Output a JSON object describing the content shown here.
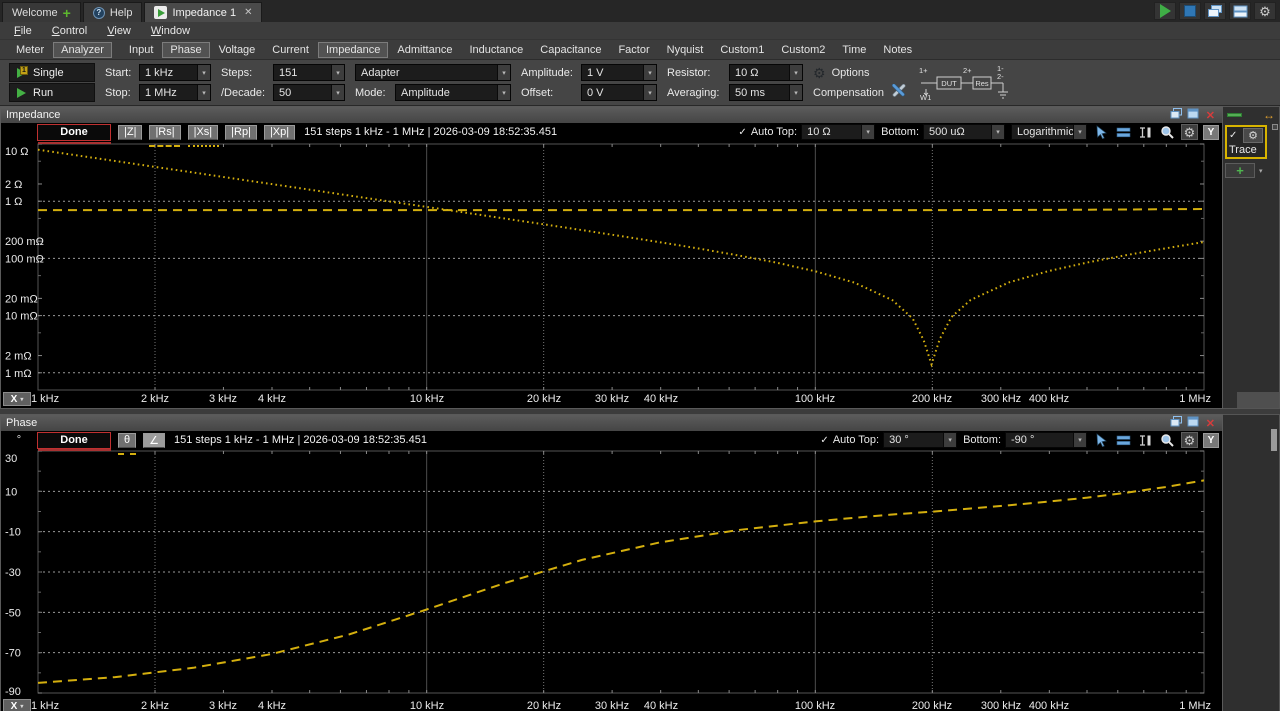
{
  "app": {
    "tabs": [
      {
        "label": "Welcome",
        "icon": "plus"
      },
      {
        "label": "Help",
        "icon": "help"
      },
      {
        "label": "Impedance 1",
        "icon": "play",
        "closable": true,
        "active": true
      }
    ],
    "menus": [
      "File",
      "Control",
      "View",
      "Window"
    ],
    "view_tabs": [
      {
        "label": "Meter"
      },
      {
        "label": "Analyzer",
        "selected": true,
        "gap_after": true
      },
      {
        "label": "Input"
      },
      {
        "label": "Phase",
        "selected": true
      },
      {
        "label": "Voltage"
      },
      {
        "label": "Current"
      },
      {
        "label": "Impedance",
        "selected": true
      },
      {
        "label": "Admittance"
      },
      {
        "label": "Inductance"
      },
      {
        "label": "Capacitance"
      },
      {
        "label": "Factor"
      },
      {
        "label": "Nyquist"
      },
      {
        "label": "Custom1"
      },
      {
        "label": "Custom2"
      },
      {
        "label": "Time"
      },
      {
        "label": "Notes"
      }
    ],
    "window_buttons": [
      "run",
      "stop",
      "cascade",
      "tile",
      "settings"
    ]
  },
  "toolbar": {
    "single_label": "Single",
    "run_label": "Run",
    "columns": [
      [
        {
          "label": "Start:",
          "value": "1 kHz"
        },
        {
          "label": "Stop:",
          "value": "1 MHz"
        }
      ],
      [
        {
          "label": "Steps:",
          "value": "151"
        },
        {
          "label": "/Decade:",
          "value": "50"
        }
      ],
      [
        {
          "label": "",
          "value": "Adapter"
        },
        {
          "label": "Mode:",
          "value": "Amplitude"
        }
      ],
      [
        {
          "label": "Amplitude:",
          "value": "1 V"
        },
        {
          "label": "Offset:",
          "value": "0 V"
        }
      ],
      [
        {
          "label": "Resistor:",
          "value": "10 Ω"
        },
        {
          "label": "Averaging:",
          "value": "50 ms"
        }
      ]
    ],
    "options_label": "Options",
    "compensation_label": "Compensation",
    "diagram": {
      "p1": "1+",
      "p2": "2+",
      "m1": "1-",
      "m2": "2-",
      "dut": "DUT",
      "res": "Res",
      "w1": "W1"
    }
  },
  "impedance_panel": {
    "title": "Impedance",
    "unit": "",
    "done_label": "Done",
    "trace_buttons": [
      {
        "label": "|Z|"
      },
      {
        "label": "|Rs|",
        "mark": "dashed"
      },
      {
        "label": "|Xs|",
        "mark": "dotted"
      },
      {
        "label": "|Rp|"
      },
      {
        "label": "|Xp|"
      }
    ],
    "status": "151 steps 1 kHz - 1 MHz | 2026-03-09 18:52:35.451",
    "auto_top_label": "Auto Top:",
    "auto_top_value": "10 Ω",
    "bottom_label": "Bottom:",
    "bottom_value": "500 uΩ",
    "scale_value": "Logarithmic",
    "y_button": "Y",
    "x_button": "X"
  },
  "phase_panel": {
    "title": "Phase",
    "unit": "°",
    "done_label": "Done",
    "trace_buttons": [
      {
        "label": "θ",
        "mark": "dashed"
      },
      {
        "label": "∠",
        "active": true
      }
    ],
    "status": "151 steps 1 kHz - 1 MHz | 2026-03-09 18:52:35.451",
    "auto_top_label": "Auto Top:",
    "auto_top_value": "30 °",
    "bottom_label": "Bottom:",
    "bottom_value": "-90 °",
    "y_button": "Y",
    "x_button": "X"
  },
  "sidebar": {
    "trace_label": "Trace"
  },
  "colors": {
    "trace_yellow": "#d4af0e",
    "done_red": "#c03030",
    "accent_green": "#44b044",
    "accent_blue": "#5a9bd8",
    "selection_yellow": "#d8b400",
    "grid_gray": "#9a9a9a"
  },
  "chart_data": [
    {
      "id": "impedance",
      "type": "line",
      "title": "Impedance",
      "x_scale": "log",
      "y_scale": "log",
      "x_range_hz": [
        1000,
        1000000
      ],
      "y_range_ohm": [
        0.0005,
        10
      ],
      "x_ticks": [
        {
          "f": 1000,
          "label": "1 kHz"
        },
        {
          "f": 2000,
          "label": "2 kHz"
        },
        {
          "f": 3000,
          "label": "3 kHz"
        },
        {
          "f": 4000,
          "label": "4 kHz"
        },
        {
          "f": 10000,
          "label": "10 kHz"
        },
        {
          "f": 20000,
          "label": "20 kHz"
        },
        {
          "f": 30000,
          "label": "30 kHz"
        },
        {
          "f": 40000,
          "label": "40 kHz"
        },
        {
          "f": 100000,
          "label": "100 kHz"
        },
        {
          "f": 200000,
          "label": "200 kHz"
        },
        {
          "f": 300000,
          "label": "300 kHz"
        },
        {
          "f": 400000,
          "label": "400 kHz"
        },
        {
          "f": 1000000,
          "label": "1 MHz"
        }
      ],
      "y_ticks": [
        {
          "v": 10,
          "label": "10 Ω"
        },
        {
          "v": 2,
          "label": "2 Ω"
        },
        {
          "v": 1,
          "label": "1 Ω"
        },
        {
          "v": 0.2,
          "label": "200 mΩ"
        },
        {
          "v": 0.1,
          "label": "100 mΩ"
        },
        {
          "v": 0.02,
          "label": "20 mΩ"
        },
        {
          "v": 0.01,
          "label": "10 mΩ"
        },
        {
          "v": 0.002,
          "label": "2 mΩ"
        },
        {
          "v": 0.001,
          "label": "1 mΩ"
        }
      ],
      "grid": {
        "v_solid": [
          10000,
          100000
        ],
        "v_dotted": [
          2000,
          20000,
          200000
        ],
        "h_dotted": [
          1,
          0.1,
          0.01,
          0.001
        ]
      },
      "series": [
        {
          "name": "|Rs|",
          "style": "dashed",
          "color": "#d4af0e",
          "points": [
            [
              1000,
              0.7
            ],
            [
              100000,
              0.7
            ],
            [
              200000,
              0.7
            ],
            [
              398000,
              0.705
            ],
            [
              631000,
              0.715
            ],
            [
              1000000,
              0.73
            ]
          ]
        },
        {
          "name": "|Xs|",
          "style": "dotted",
          "color": "#d4af0e",
          "points": [
            [
              1000,
              7.957
            ],
            [
              1260,
              6.315
            ],
            [
              1580,
              5.036
            ],
            [
              2000,
              3.979
            ],
            [
              2510,
              3.17
            ],
            [
              3160,
              2.518
            ],
            [
              3980,
              1.999
            ],
            [
              5010,
              1.587
            ],
            [
              6310,
              1.26
            ],
            [
              7940,
              1.001
            ],
            [
              10000,
              0.7938
            ],
            [
              12600,
              0.629
            ],
            [
              15800,
              0.5005
            ],
            [
              20000,
              0.3939
            ],
            [
              25100,
              0.312
            ],
            [
              31600,
              0.2455
            ],
            [
              39800,
              0.1919
            ],
            [
              50100,
              0.1488
            ],
            [
              63100,
              0.1134
            ],
            [
              79400,
              0.0843
            ],
            [
              100000,
              0.0595
            ],
            [
              126000,
              0.0378
            ],
            [
              158000,
              0.0186
            ],
            [
              178000,
              0.0089
            ],
            [
              190000,
              0.0037
            ],
            [
              199000,
              0.0014
            ],
            [
              209000,
              0.0039
            ],
            [
              224000,
              0.0095
            ],
            [
              251000,
              0.0188
            ],
            [
              316000,
              0.0384
            ],
            [
              398000,
              0.06
            ],
            [
              501000,
              0.0848
            ],
            [
              631000,
              0.1143
            ],
            [
              794000,
              0.1496
            ],
            [
              1000000,
              0.1931
            ]
          ]
        }
      ]
    },
    {
      "id": "phase",
      "type": "line",
      "title": "Phase",
      "x_scale": "log",
      "y_scale": "linear",
      "x_range_hz": [
        1000,
        1000000
      ],
      "y_range_deg": [
        -90,
        30
      ],
      "x_ticks": [
        {
          "f": 1000,
          "label": "1 kHz"
        },
        {
          "f": 2000,
          "label": "2 kHz"
        },
        {
          "f": 3000,
          "label": "3 kHz"
        },
        {
          "f": 4000,
          "label": "4 kHz"
        },
        {
          "f": 10000,
          "label": "10 kHz"
        },
        {
          "f": 20000,
          "label": "20 kHz"
        },
        {
          "f": 30000,
          "label": "30 kHz"
        },
        {
          "f": 40000,
          "label": "40 kHz"
        },
        {
          "f": 100000,
          "label": "100 kHz"
        },
        {
          "f": 200000,
          "label": "200 kHz"
        },
        {
          "f": 300000,
          "label": "300 kHz"
        },
        {
          "f": 400000,
          "label": "400 kHz"
        },
        {
          "f": 1000000,
          "label": "1 MHz"
        }
      ],
      "y_ticks": [
        {
          "v": 30,
          "label": "30"
        },
        {
          "v": 10,
          "label": "10"
        },
        {
          "v": -10,
          "label": "-10"
        },
        {
          "v": -30,
          "label": "-30"
        },
        {
          "v": -50,
          "label": "-50"
        },
        {
          "v": -70,
          "label": "-70"
        },
        {
          "v": -90,
          "label": "-90"
        }
      ],
      "grid": {
        "v_solid": [
          10000,
          100000
        ],
        "v_dotted": [
          2000,
          20000,
          200000
        ],
        "h_dotted": [
          10,
          -10,
          -30,
          -50,
          -70
        ]
      },
      "series": [
        {
          "name": "θ",
          "style": "dashed",
          "color": "#d4af0e",
          "points": [
            [
              1000,
              -85.0
            ],
            [
              1580,
              -82.1
            ],
            [
              2510,
              -77.5
            ],
            [
              3980,
              -70.7
            ],
            [
              6310,
              -61.0
            ],
            [
              10000,
              -48.6
            ],
            [
              15800,
              -35.6
            ],
            [
              25100,
              -24.0
            ],
            [
              39800,
              -15.3
            ],
            [
              63100,
              -9.2
            ],
            [
              100000,
              -4.9
            ],
            [
              126000,
              -3.1
            ],
            [
              158000,
              -1.5
            ],
            [
              199000,
              -0.1
            ],
            [
              251000,
              1.5
            ],
            [
              316000,
              3.1
            ],
            [
              398000,
              4.9
            ],
            [
              501000,
              6.9
            ],
            [
              631000,
              9.3
            ],
            [
              794000,
              12.1
            ],
            [
              1000000,
              15.4
            ]
          ]
        }
      ]
    }
  ]
}
